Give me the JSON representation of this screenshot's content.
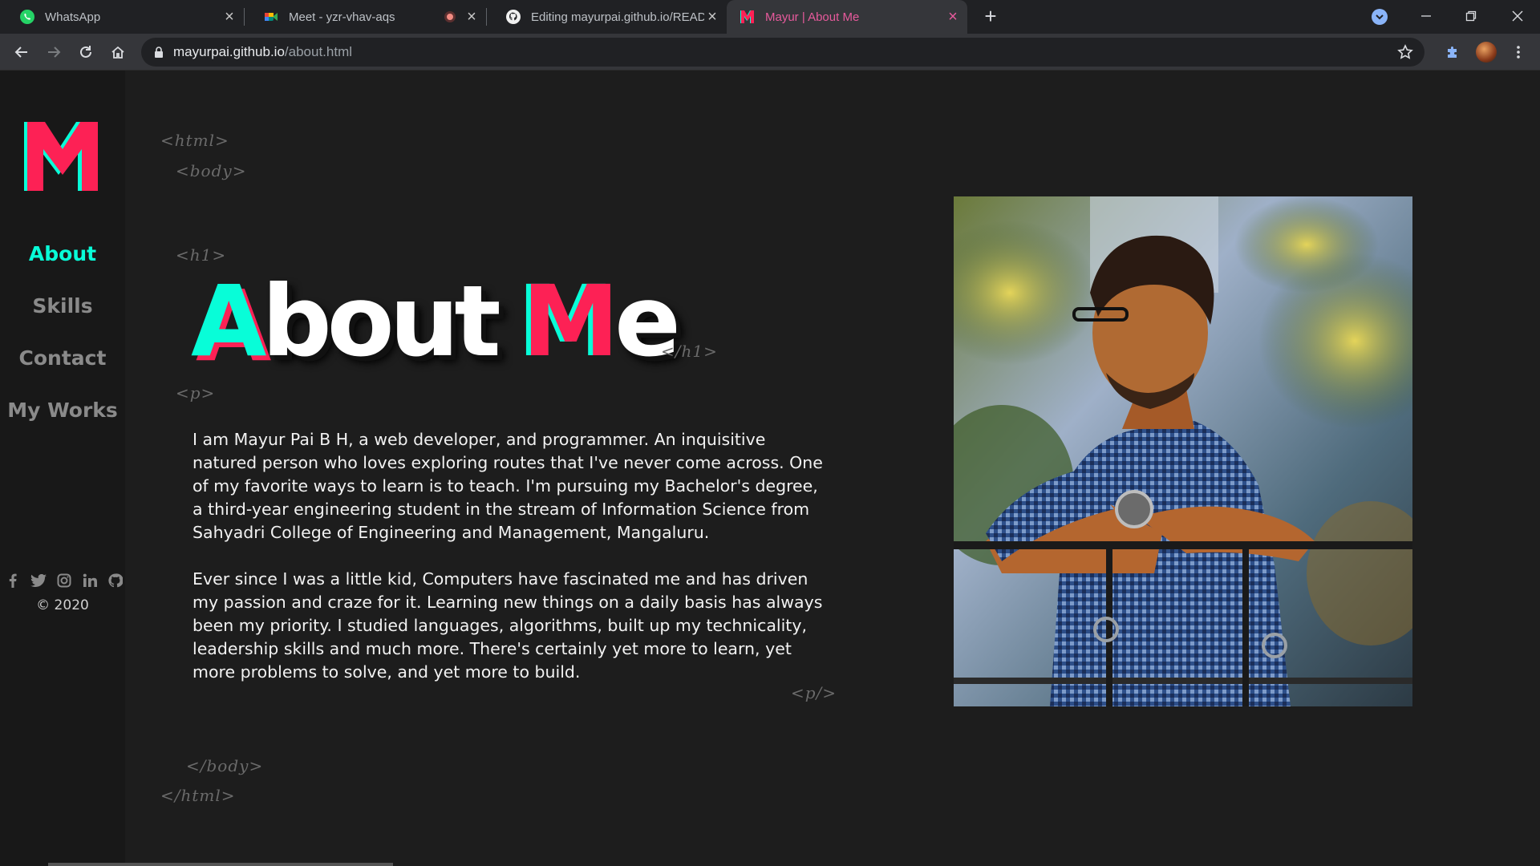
{
  "browser": {
    "tabs": [
      {
        "title": "WhatsApp",
        "icon": "whatsapp-icon"
      },
      {
        "title": "Meet - yzr-vhav-aqs",
        "icon": "google-meet-icon"
      },
      {
        "title": "Editing mayurpai.github.io/README",
        "icon": "github-icon"
      },
      {
        "title": "Mayur | About Me",
        "icon": "site-m-logo-icon"
      }
    ],
    "active_tab": 3,
    "url_host": "mayurpai.github.io",
    "url_path": "/about.html"
  },
  "sidebar": {
    "logo_letter": "M",
    "nav": [
      {
        "label": "About",
        "active": true
      },
      {
        "label": "Skills",
        "active": false
      },
      {
        "label": "Contact",
        "active": false
      },
      {
        "label": "My Works",
        "active": false
      }
    ],
    "socials": [
      "facebook-icon",
      "twitter-icon",
      "instagram-icon",
      "linkedin-icon",
      "github-icon"
    ],
    "copyright": "© 2020"
  },
  "content": {
    "tags": {
      "html_open": "<html>",
      "body_open": "<body>",
      "h1_open": "<h1>",
      "h1_close": "</h1>",
      "p_open": "<p>",
      "p_close": "<p/>",
      "body_close": "</body>",
      "html_close": "</html>"
    },
    "heading": {
      "first_letter": "A",
      "rest_first": "bout",
      "accent_letter": "M",
      "rest_second": "e"
    },
    "paragraphs": [
      "I am Mayur Pai B H, a web developer, and programmer. An inquisitive natured person who loves exploring routes that I've never come across. One of my favorite ways to learn is to teach. I'm pursuing my Bachelor's degree, a third-year engineering student in the stream of Information Science from Sahyadri College of Engineering and Management, Mangaluru.",
      "Ever since I was a little kid, Computers have fascinated me and has driven my passion and craze for it. Learning new things on a daily basis has always been my priority. I studied languages, algorithms, built up my technicality, leadership skills and much more. There's certainly yet more to learn, yet more problems to solve, and yet more to build."
    ]
  },
  "colors": {
    "accent_cyan": "#08fdd8",
    "accent_pink": "#fd2155",
    "page_bg": "#1d1d1d",
    "sidebar_bg": "#181818"
  }
}
